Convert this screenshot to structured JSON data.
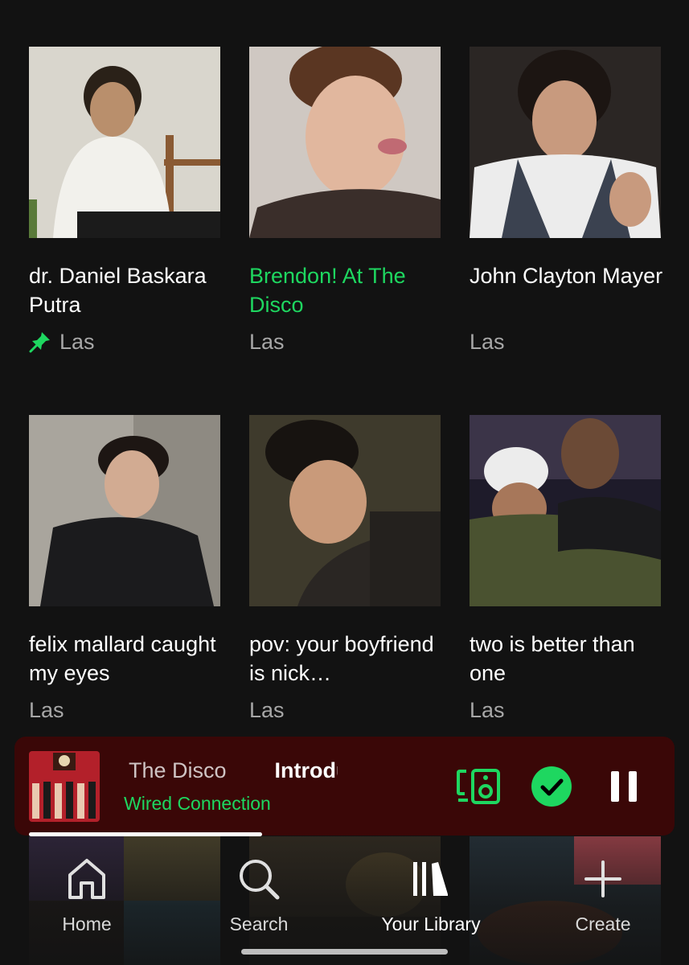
{
  "library_items": [
    {
      "title": "dr. Daniel Baskara Putra",
      "subtitle": "Las",
      "pinned": true,
      "active": false
    },
    {
      "title": "Brendon! At The Disco",
      "subtitle": "Las",
      "pinned": false,
      "active": true
    },
    {
      "title": "John Clayton Mayer",
      "subtitle": "Las",
      "pinned": false,
      "active": false
    },
    {
      "title": "felix mallard caught my eyes",
      "subtitle": "Las",
      "pinned": false,
      "active": false
    },
    {
      "title": "pov: your boyfriend is nick…",
      "subtitle": "Las",
      "pinned": false,
      "active": false
    },
    {
      "title": "two is better than one",
      "subtitle": "Las",
      "pinned": false,
      "active": false
    }
  ],
  "mini_player": {
    "track_title_lead": "The Disco",
    "track_title_next": "Introdu",
    "device": "Wired Connection",
    "progress": 0.37,
    "icons": {
      "device": "connect-device-icon",
      "saved": "check-circle-icon",
      "pause": "pause-icon"
    }
  },
  "nav": {
    "items": [
      {
        "label": "Home",
        "icon": "home-icon",
        "active": false
      },
      {
        "label": "Search",
        "icon": "search-icon",
        "active": false
      },
      {
        "label": "Your Library",
        "icon": "library-icon",
        "active": true
      },
      {
        "label": "Create",
        "icon": "plus-icon",
        "active": false
      }
    ]
  },
  "colors": {
    "background": "#121212",
    "accent": "#1ed760",
    "mini_player_bg": "#3a0707",
    "subtitle": "#a7a7a7"
  }
}
